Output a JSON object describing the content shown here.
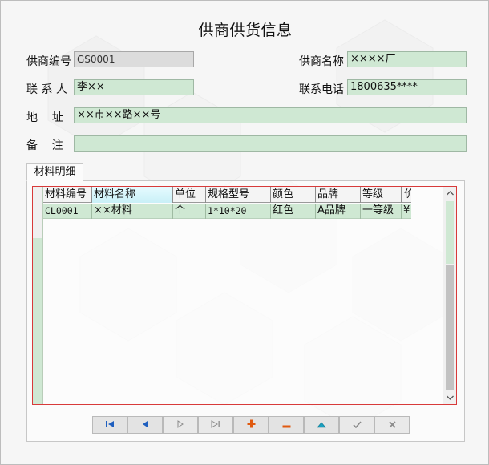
{
  "title": "供商供货信息",
  "form": {
    "supplier_code_label": "供商编号",
    "supplier_code_value": "GS0001",
    "supplier_name_label": "供商名称",
    "supplier_name_value": "××××厂",
    "contact_label": "联 系 人",
    "contact_value": "李××",
    "phone_label": "联系电话",
    "phone_value": "1800635****",
    "address_label": "地    址",
    "address_value": "××市××路××号",
    "remark_label": "备    注",
    "remark_value": ""
  },
  "tab": {
    "label": "材料明细"
  },
  "grid": {
    "columns": [
      "材料编号",
      "材料名称",
      "单位",
      "规格型号",
      "颜色",
      "品牌",
      "等级",
      "价"
    ],
    "rows": [
      [
        "CL0001",
        "××材料",
        "个",
        "1*10*20",
        "红色",
        "A品牌",
        "一等级",
        "¥"
      ]
    ]
  },
  "navigator": {
    "buttons": [
      "first",
      "prior",
      "next",
      "last",
      "insert",
      "delete",
      "edit",
      "post",
      "cancel"
    ]
  },
  "colors": {
    "field_green": "#cfe8d3",
    "grid_border": "#d83a3a",
    "insert_orange": "#e05a10",
    "nav_blue": "#1f5fbf"
  }
}
